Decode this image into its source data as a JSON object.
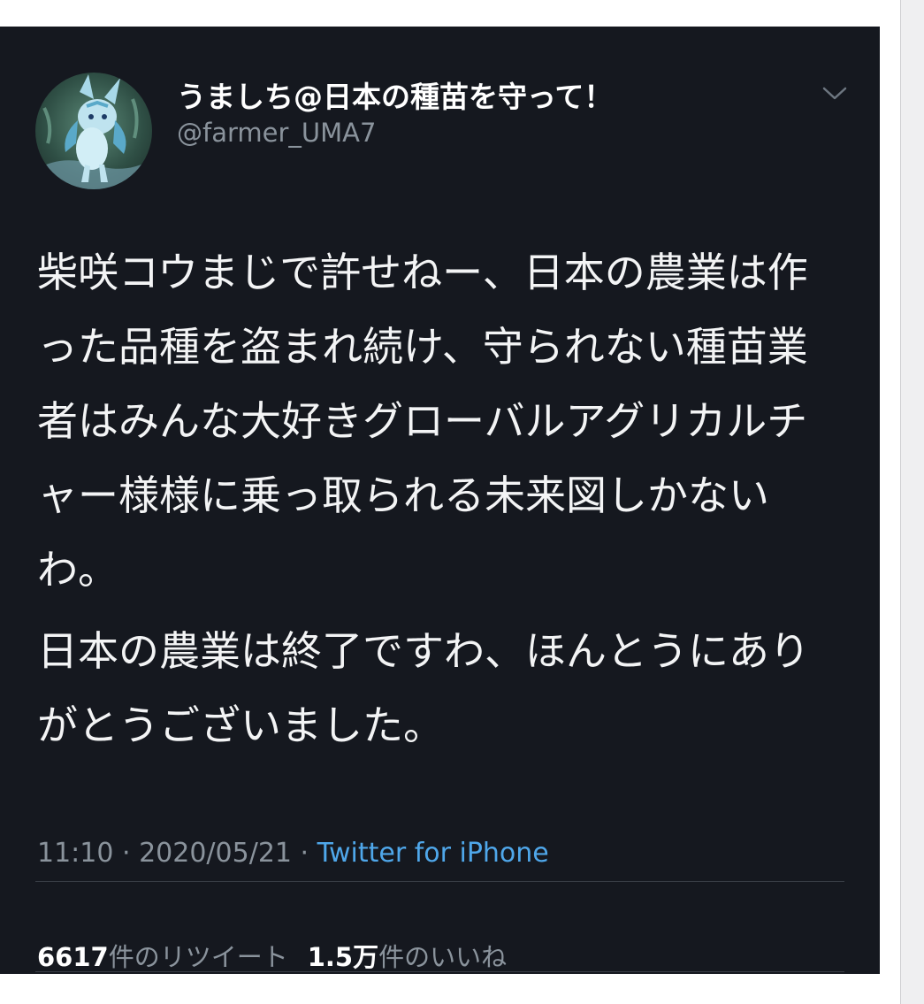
{
  "tweet": {
    "display_name": "うましち@日本の種苗を守って！",
    "handle": "@farmer_UMA7",
    "body_paragraphs": [
      "柴咲コウまじで許せねー、日本の農業は作った品種を盗まれ続け、守られない種苗業者はみんな大好きグローバルアグリカルチャー様様に乗っ取られる未来図しかないわ。",
      "日本の農業は終了ですわ、ほんとうにありがとうございました。"
    ],
    "time": "11:10",
    "date": "2020/05/21",
    "separator": " · ",
    "source": "Twitter for iPhone",
    "retweet_count": "6617",
    "retweet_label": "件のリツイート",
    "like_count": "1.5万",
    "like_label": "件のいいね",
    "avatar_icon": "glaceon-avatar-icon",
    "menu_icon": "chevron-down-icon"
  },
  "colors": {
    "card_background": "#15181f",
    "body_text": "#f3f4f5",
    "secondary_text": "#8a939c",
    "link": "#4fa7ea",
    "divider": "#383d45"
  }
}
